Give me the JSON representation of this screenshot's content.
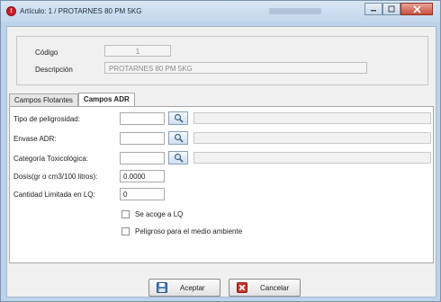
{
  "window": {
    "title": "Artículo: 1 / PROTARNES 80 PM 5KG",
    "icon": "app-error-icon",
    "controls": [
      "minimize",
      "maximize",
      "close"
    ]
  },
  "header": {
    "codigo_label": "Código",
    "codigo_value": "1",
    "descripcion_label": "Descripción",
    "descripcion_value": "PROTARNES 80 PM 5KG"
  },
  "tabs": [
    {
      "label": "Campos Flotantes",
      "active": false
    },
    {
      "label": "Campos ADR",
      "active": true
    }
  ],
  "adr": {
    "tipo_peligrosidad_label": "Tipo de peligrosidad:",
    "tipo_peligrosidad_value": "",
    "envase_label": "Envase ADR:",
    "envase_value": "",
    "categoria_label": "Categoría Toxicológica:",
    "categoria_value": "",
    "dosis_label": "Dosis(gr o cm3/100 litros):",
    "dosis_value": "0.0000",
    "cantidad_label": "Cantidad Limitada en LQ:",
    "cantidad_value": "0",
    "lq_checkbox_label": "Se acoge a LQ",
    "lq_checked": false,
    "ambiente_checkbox_label": "Peligroso para el medio ambiente",
    "ambiente_checked": false
  },
  "footer": {
    "accept_label": "Aceptar",
    "cancel_label": "Cancelar"
  },
  "icons": {
    "lookup": "magnifier-icon",
    "accept": "save-disk-icon",
    "cancel": "red-x-icon"
  },
  "colors": {
    "title_bar": "#c2d6eb",
    "close_button": "#c9503e",
    "app_icon": "#c8202a"
  }
}
